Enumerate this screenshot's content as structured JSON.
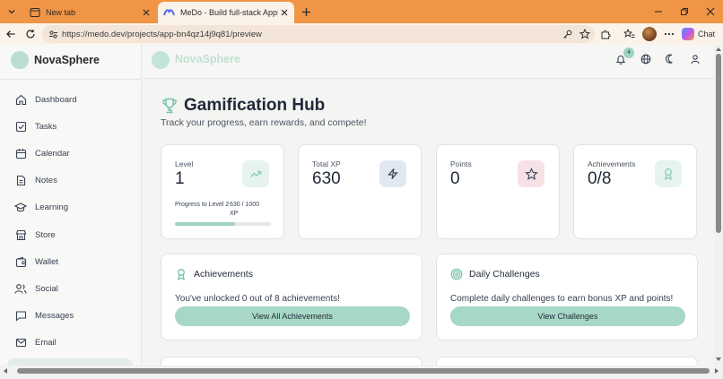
{
  "browser": {
    "tabs": [
      {
        "title": "New tab",
        "icon": "new-tab-page-icon"
      },
      {
        "title": "MeDo - Build full-stack Apps With",
        "icon": "medo-favicon"
      }
    ],
    "url": "https://medo.dev/projects/app-bn4qz14j9q81/preview",
    "chat_label": "Chat"
  },
  "app": {
    "brand": "NovaSphere",
    "notifications_count": "4",
    "accent": "#9fd3bf"
  },
  "sidebar": {
    "items": [
      {
        "label": "Dashboard",
        "icon": "home-icon"
      },
      {
        "label": "Tasks",
        "icon": "checkbox-icon"
      },
      {
        "label": "Calendar",
        "icon": "calendar-icon"
      },
      {
        "label": "Notes",
        "icon": "file-text-icon"
      },
      {
        "label": "Learning",
        "icon": "graduation-cap-icon"
      },
      {
        "label": "Store",
        "icon": "store-icon"
      },
      {
        "label": "Wallet",
        "icon": "wallet-icon"
      },
      {
        "label": "Social",
        "icon": "users-icon"
      },
      {
        "label": "Messages",
        "icon": "message-square-icon"
      },
      {
        "label": "Email",
        "icon": "mail-icon"
      }
    ]
  },
  "hub": {
    "title": "Gamification Hub",
    "subtitle": "Track your progress, earn rewards, and compete!"
  },
  "stats": {
    "level": {
      "label": "Level",
      "value": "1",
      "progress_label": "Progress to Level 2",
      "progress_value": "630 / 1000 XP",
      "progress_fraction": 0.63
    },
    "xp": {
      "label": "Total XP",
      "value": "630"
    },
    "points": {
      "label": "Points",
      "value": "0"
    },
    "achievements": {
      "label": "Achievements",
      "value": "0/8"
    }
  },
  "achievements_card": {
    "title": "Achievements",
    "text": "You've unlocked 0 out of 8 achievements!",
    "button": "View All Achievements"
  },
  "challenges_card": {
    "title": "Daily Challenges",
    "text": "Complete daily challenges to earn bonus XP and points!",
    "button": "View Challenges"
  }
}
